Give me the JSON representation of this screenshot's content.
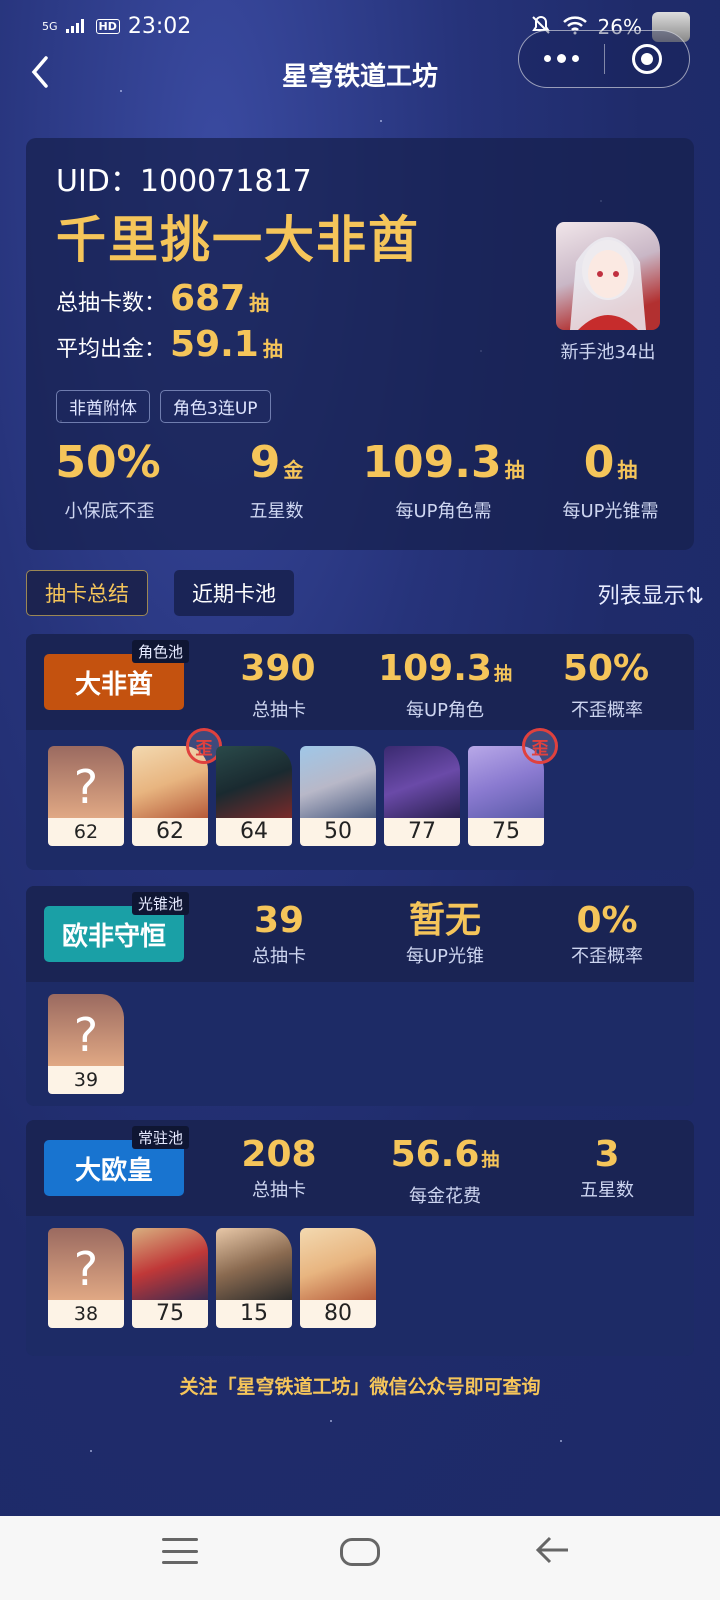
{
  "status_bar": {
    "network": "5G",
    "hd": "HD",
    "time": "23:02",
    "battery": "26%"
  },
  "nav": {
    "title": "星穹铁道工坊"
  },
  "summary": {
    "uid": "UID：100071817",
    "nickname": "千里挑一大非酋",
    "total_label": "总抽卡数：",
    "total_value": "687",
    "total_unit": "抽",
    "avg_label": "平均出金：",
    "avg_value": "59.1",
    "avg_unit": "抽",
    "portrait_caption": "新手池34出",
    "tags": [
      "非酋附体",
      "角色3连UP"
    ],
    "stats": [
      {
        "value": "50%",
        "unit": "",
        "label": "小保底不歪"
      },
      {
        "value": "9",
        "unit": "金",
        "label": "五星数"
      },
      {
        "value": "109.3",
        "unit": "抽",
        "label": "每UP角色需"
      },
      {
        "value": "0",
        "unit": "抽",
        "label": "每UP光锥需"
      }
    ]
  },
  "tabs": {
    "summary": "抽卡总结",
    "recent": "近期卡池",
    "list_view": "列表显示⇅"
  },
  "pools": {
    "character": {
      "type": "角色池",
      "badge": "大非酋",
      "badge_color": "#c4520f",
      "stats": [
        {
          "value": "390",
          "unit": "",
          "label": "总抽卡"
        },
        {
          "value": "109.3",
          "unit": "抽",
          "label": "每UP角色"
        },
        {
          "value": "50%",
          "unit": "",
          "label": "不歪概率"
        }
      ],
      "pending": "62",
      "chars": [
        {
          "count": "62",
          "wai": "歪"
        },
        {
          "count": "64",
          "wai": ""
        },
        {
          "count": "50",
          "wai": ""
        },
        {
          "count": "77",
          "wai": ""
        },
        {
          "count": "75",
          "wai": "歪"
        }
      ]
    },
    "lightcone": {
      "type": "光锥池",
      "badge": "欧非守恒",
      "badge_color": "#1aa0a6",
      "stats": [
        {
          "value": "39",
          "unit": "",
          "label": "总抽卡"
        },
        {
          "value": "暂无",
          "unit": "",
          "label": "每UP光锥"
        },
        {
          "value": "0%",
          "unit": "",
          "label": "不歪概率"
        }
      ],
      "pending": "39"
    },
    "standard": {
      "type": "常驻池",
      "badge": "大欧皇",
      "badge_color": "#1874d0",
      "stats": [
        {
          "value": "208",
          "unit": "",
          "label": "总抽卡"
        },
        {
          "value": "56.6",
          "unit": "抽",
          "label": "每金花费"
        },
        {
          "value": "3",
          "unit": "",
          "label": "五星数"
        }
      ],
      "pending": "38",
      "chars": [
        {
          "count": "75"
        },
        {
          "count": "15"
        },
        {
          "count": "80"
        }
      ]
    }
  },
  "footer_note": "关注「星穹铁道工坊」微信公众号即可查询",
  "icons": [
    "back-arrow-icon",
    "more-dots-icon",
    "target-icon",
    "wifi-icon",
    "mute-icon",
    "menu-icon",
    "home-icon",
    "back-icon"
  ],
  "colors": {
    "accent": "#f5c55a",
    "background": "#26337a",
    "wai_red": "#e0413e"
  }
}
